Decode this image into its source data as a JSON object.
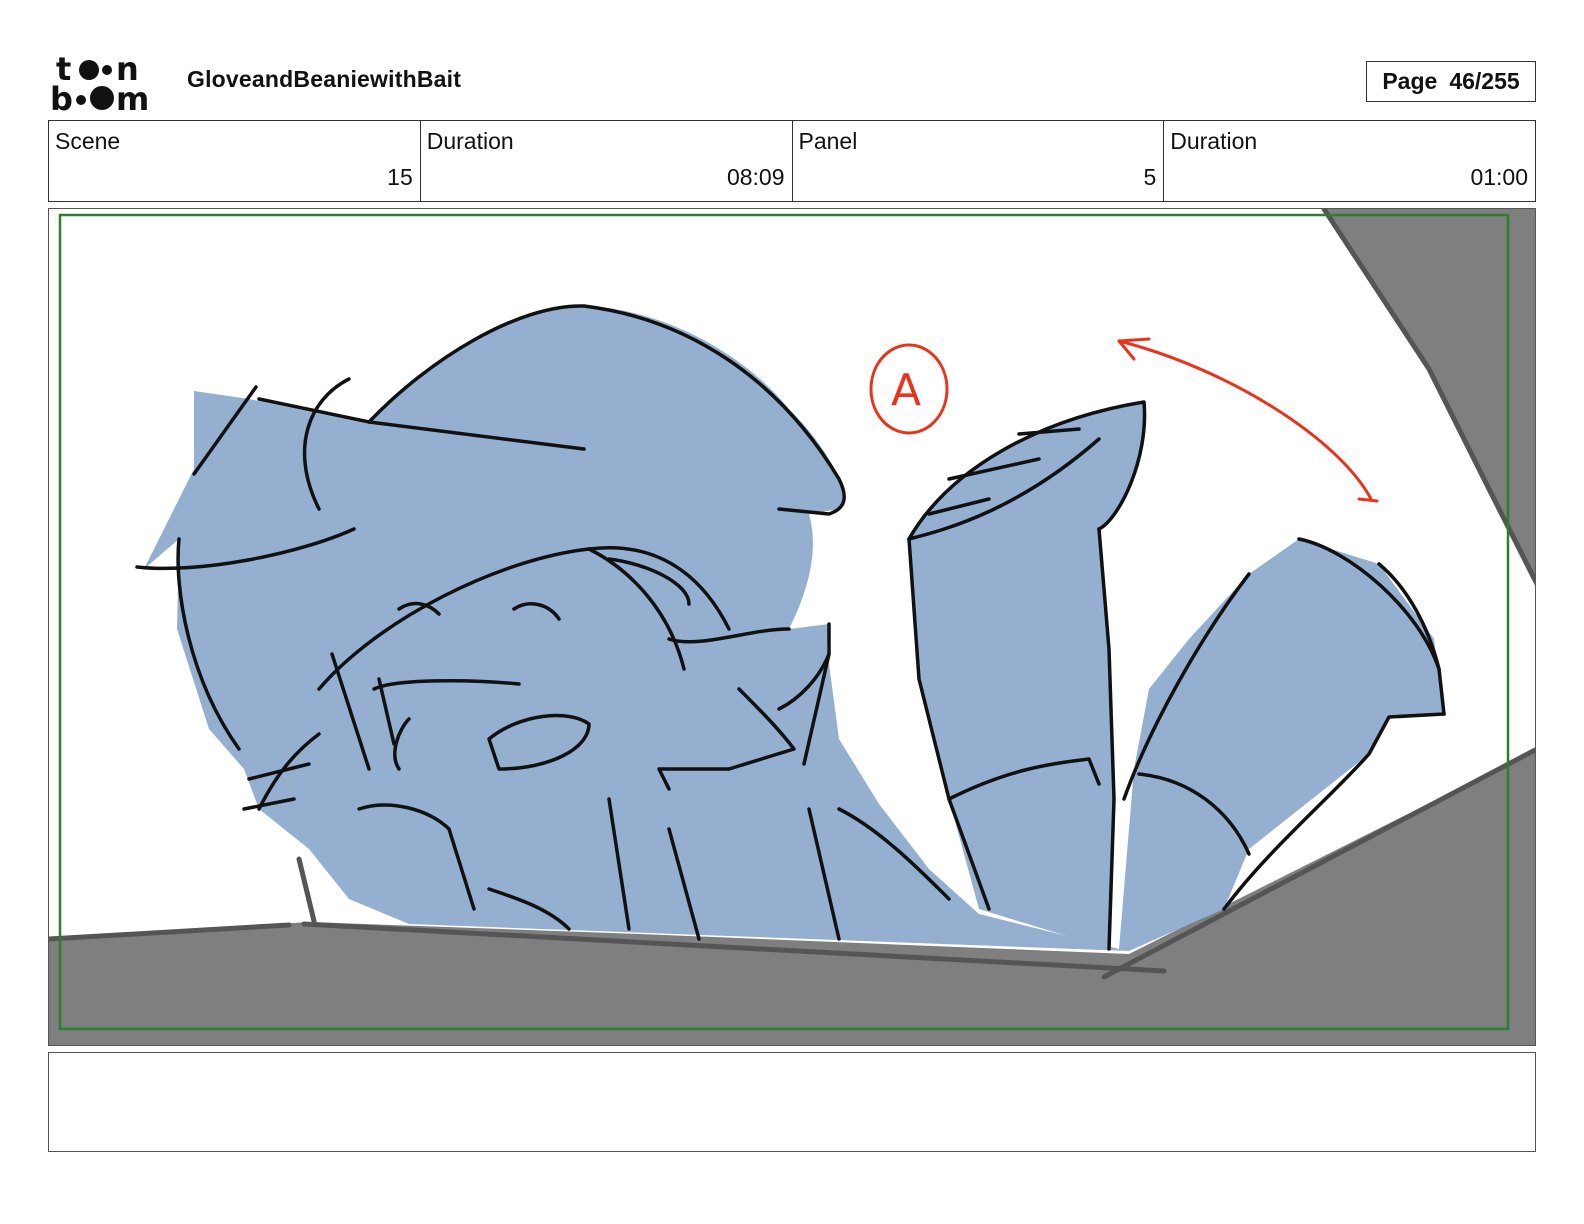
{
  "header": {
    "logo_icon": "toonboom-logo",
    "project_title": "GloveandBeaniewithBait",
    "page_label": "Page",
    "page_number": "46/255"
  },
  "info": {
    "scene_label": "Scene",
    "scene_value": "15",
    "scene_duration_label": "Duration",
    "scene_duration_value": "08:09",
    "panel_label": "Panel",
    "panel_value": "5",
    "panel_duration_label": "Duration",
    "panel_duration_value": "01:00"
  },
  "panel": {
    "annotation_letter": "A",
    "colors": {
      "character_fill": "#94afd0",
      "ground_fill": "#7f7f7f",
      "annotation_red": "#e8341c",
      "safe_area_green": "#2e7d32"
    }
  },
  "dialog": {
    "text": ""
  }
}
